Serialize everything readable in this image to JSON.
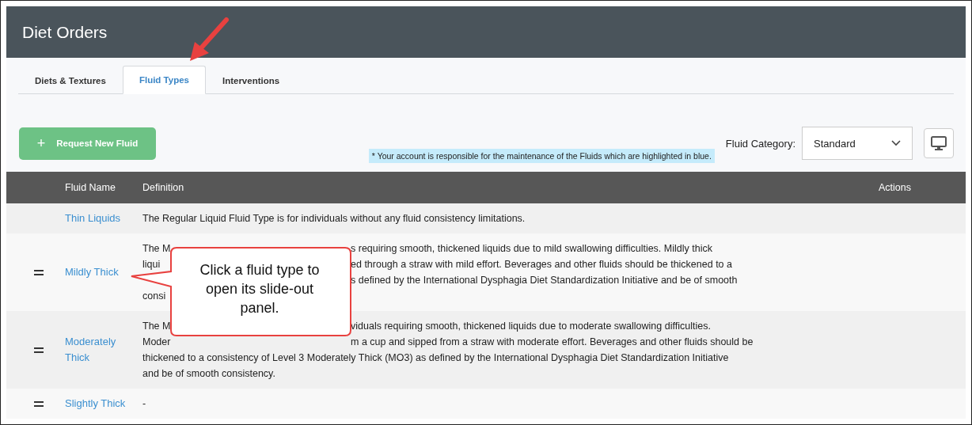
{
  "header": {
    "title": "Diet Orders"
  },
  "tabs": [
    {
      "label": "Diets & Textures",
      "selected": false
    },
    {
      "label": "Fluid Types",
      "selected": true
    },
    {
      "label": "Interventions",
      "selected": false
    }
  ],
  "toolbar": {
    "request_button": {
      "icon": "+",
      "label": "Request New Fluid"
    },
    "notice": "* Your account is responsible for the maintenance of the Fluids which are highlighted in blue.",
    "category_label": "Fluid Category:",
    "category_value": "Standard"
  },
  "table": {
    "columns": [
      "Fluid Name",
      "Definition",
      "Actions"
    ],
    "rows": [
      {
        "name": [
          "Thin Liquids"
        ],
        "draggable": false,
        "definition": [
          [
            {
              "kind": "whole",
              "text": "The Regular Liquid Fluid Type is for individuals without any fluid consistency limitations."
            }
          ]
        ]
      },
      {
        "name": [
          "Mildly Thick"
        ],
        "draggable": true,
        "definition": [
          [
            {
              "kind": "before",
              "text": "The M"
            },
            {
              "kind": "after",
              "text": "s requiring smooth, thickened liquids due to mild swallowing difficulties. Mildly thick"
            }
          ],
          [
            {
              "kind": "before",
              "text": "liqui"
            },
            {
              "kind": "after",
              "text": "ed through a straw with mild effort. Beverages and other fluids should be thickened to a"
            }
          ],
          [
            {
              "kind": "after",
              "text": "s defined by the International Dysphagia Diet Standardization Initiative and be of smooth"
            }
          ],
          [
            {
              "kind": "before",
              "text": "consi"
            }
          ]
        ]
      },
      {
        "name": [
          "Moderately",
          "Thick"
        ],
        "draggable": true,
        "definition": [
          [
            {
              "kind": "before",
              "text": "The M"
            },
            {
              "kind": "after",
              "text": "viduals requiring smooth, thickened liquids due to moderate swallowing difficulties."
            }
          ],
          [
            {
              "kind": "before",
              "text": "Moder"
            },
            {
              "kind": "after",
              "text": "m a cup and sipped from a straw with moderate effort. Beverages and other fluids should be"
            }
          ],
          [
            {
              "kind": "whole",
              "text": "thickened to a consistency of Level 3 Moderately Thick (MO3) as defined by the International Dysphagia Diet Standardization Initiative"
            }
          ],
          [
            {
              "kind": "whole",
              "text": "and be of smooth consistency."
            }
          ]
        ]
      },
      {
        "name": [
          "Slightly Thick"
        ],
        "draggable": true,
        "definition": [
          [
            {
              "kind": "whole",
              "text": "-"
            }
          ]
        ]
      }
    ]
  },
  "callout": {
    "text": "Click a fluid type to open its slide-out panel."
  }
}
